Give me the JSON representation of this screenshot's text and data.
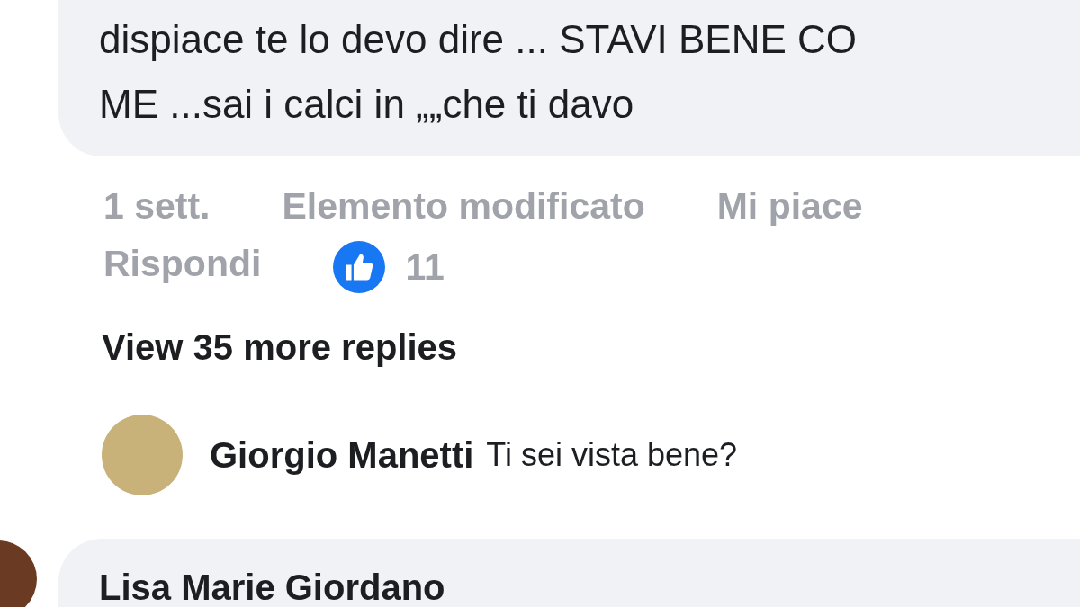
{
  "comment": {
    "lines": [
      "dispiace te lo devo dire ... STAVI BENE CO",
      "ME ...sai i calci in „„che ti davo"
    ],
    "time": "1 sett.",
    "edited": "Elemento modificato",
    "like": "Mi piace",
    "reply": "Rispondi",
    "reactions": "11"
  },
  "more_replies": "View 35 more replies",
  "reply": {
    "author": "Giorgio Manetti",
    "text": "Ti sei vista bene?"
  },
  "next_comment": {
    "author": "Lisa Marie Giordano"
  }
}
